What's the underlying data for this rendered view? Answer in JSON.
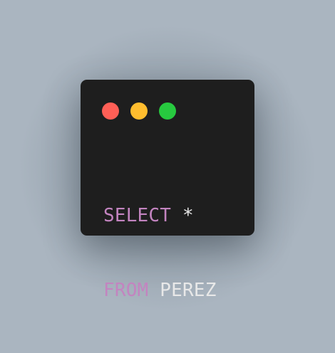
{
  "colors": {
    "background": "#aab5c0",
    "window": "#1e1e1e",
    "keyword": "#c384c0",
    "text": "#e8e8e8",
    "dot_red": "#ff5f56",
    "dot_yellow": "#ffbd2e",
    "dot_green": "#27c93f"
  },
  "window_controls": [
    {
      "name": "close",
      "color": "#ff5f56"
    },
    {
      "name": "minimize",
      "color": "#ffbd2e"
    },
    {
      "name": "maximize",
      "color": "#27c93f"
    }
  ],
  "code": {
    "line1": {
      "keyword": "SELECT",
      "rest": " *"
    },
    "line2": {
      "keyword": "FROM",
      "rest": " PEREZ"
    }
  }
}
